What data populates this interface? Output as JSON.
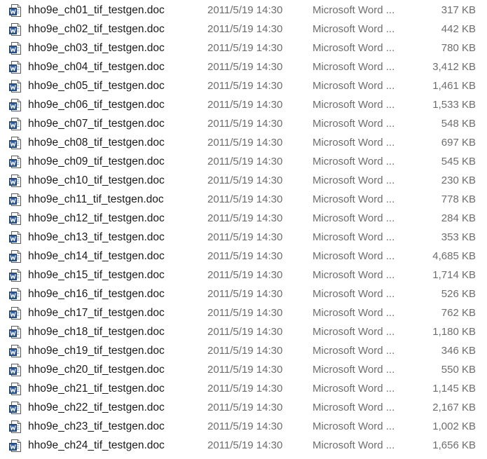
{
  "file_list": {
    "icon": "word-document-icon",
    "colors": {
      "name_text": "#1a1a1a",
      "meta_text": "#6d6d6d",
      "word_blue": "#2b579a"
    },
    "rows": [
      {
        "name": "hho9e_ch01_tif_testgen.doc",
        "date": "2011/5/19 14:30",
        "type": "Microsoft Word ...",
        "size": "317 KB"
      },
      {
        "name": "hho9e_ch02_tif_testgen.doc",
        "date": "2011/5/19 14:30",
        "type": "Microsoft Word ...",
        "size": "442 KB"
      },
      {
        "name": "hho9e_ch03_tif_testgen.doc",
        "date": "2011/5/19 14:30",
        "type": "Microsoft Word ...",
        "size": "780 KB"
      },
      {
        "name": "hho9e_ch04_tif_testgen.doc",
        "date": "2011/5/19 14:30",
        "type": "Microsoft Word ...",
        "size": "3,412 KB"
      },
      {
        "name": "hho9e_ch05_tif_testgen.doc",
        "date": "2011/5/19 14:30",
        "type": "Microsoft Word ...",
        "size": "1,461 KB"
      },
      {
        "name": "hho9e_ch06_tif_testgen.doc",
        "date": "2011/5/19 14:30",
        "type": "Microsoft Word ...",
        "size": "1,533 KB"
      },
      {
        "name": "hho9e_ch07_tif_testgen.doc",
        "date": "2011/5/19 14:30",
        "type": "Microsoft Word ...",
        "size": "548 KB"
      },
      {
        "name": "hho9e_ch08_tif_testgen.doc",
        "date": "2011/5/19 14:30",
        "type": "Microsoft Word ...",
        "size": "697 KB"
      },
      {
        "name": "hho9e_ch09_tif_testgen.doc",
        "date": "2011/5/19 14:30",
        "type": "Microsoft Word ...",
        "size": "545 KB"
      },
      {
        "name": "hho9e_ch10_tif_testgen.doc",
        "date": "2011/5/19 14:30",
        "type": "Microsoft Word ...",
        "size": "230 KB"
      },
      {
        "name": "hho9e_ch11_tif_testgen.doc",
        "date": "2011/5/19 14:30",
        "type": "Microsoft Word ...",
        "size": "778 KB"
      },
      {
        "name": "hho9e_ch12_tif_testgen.doc",
        "date": "2011/5/19 14:30",
        "type": "Microsoft Word ...",
        "size": "284 KB"
      },
      {
        "name": "hho9e_ch13_tif_testgen.doc",
        "date": "2011/5/19 14:30",
        "type": "Microsoft Word ...",
        "size": "353 KB"
      },
      {
        "name": "hho9e_ch14_tif_testgen.doc",
        "date": "2011/5/19 14:30",
        "type": "Microsoft Word ...",
        "size": "4,685 KB"
      },
      {
        "name": "hho9e_ch15_tif_testgen.doc",
        "date": "2011/5/19 14:30",
        "type": "Microsoft Word ...",
        "size": "1,714 KB"
      },
      {
        "name": "hho9e_ch16_tif_testgen.doc",
        "date": "2011/5/19 14:30",
        "type": "Microsoft Word ...",
        "size": "526 KB"
      },
      {
        "name": "hho9e_ch17_tif_testgen.doc",
        "date": "2011/5/19 14:30",
        "type": "Microsoft Word ...",
        "size": "762 KB"
      },
      {
        "name": "hho9e_ch18_tif_testgen.doc",
        "date": "2011/5/19 14:30",
        "type": "Microsoft Word ...",
        "size": "1,180 KB"
      },
      {
        "name": "hho9e_ch19_tif_testgen.doc",
        "date": "2011/5/19 14:30",
        "type": "Microsoft Word ...",
        "size": "346 KB"
      },
      {
        "name": "hho9e_ch20_tif_testgen.doc",
        "date": "2011/5/19 14:30",
        "type": "Microsoft Word ...",
        "size": "550 KB"
      },
      {
        "name": "hho9e_ch21_tif_testgen.doc",
        "date": "2011/5/19 14:30",
        "type": "Microsoft Word ...",
        "size": "1,145 KB"
      },
      {
        "name": "hho9e_ch22_tif_testgen.doc",
        "date": "2011/5/19 14:30",
        "type": "Microsoft Word ...",
        "size": "2,167 KB"
      },
      {
        "name": "hho9e_ch23_tif_testgen.doc",
        "date": "2011/5/19 14:30",
        "type": "Microsoft Word ...",
        "size": "1,002 KB"
      },
      {
        "name": "hho9e_ch24_tif_testgen.doc",
        "date": "2011/5/19 14:30",
        "type": "Microsoft Word ...",
        "size": "1,656 KB"
      }
    ]
  }
}
